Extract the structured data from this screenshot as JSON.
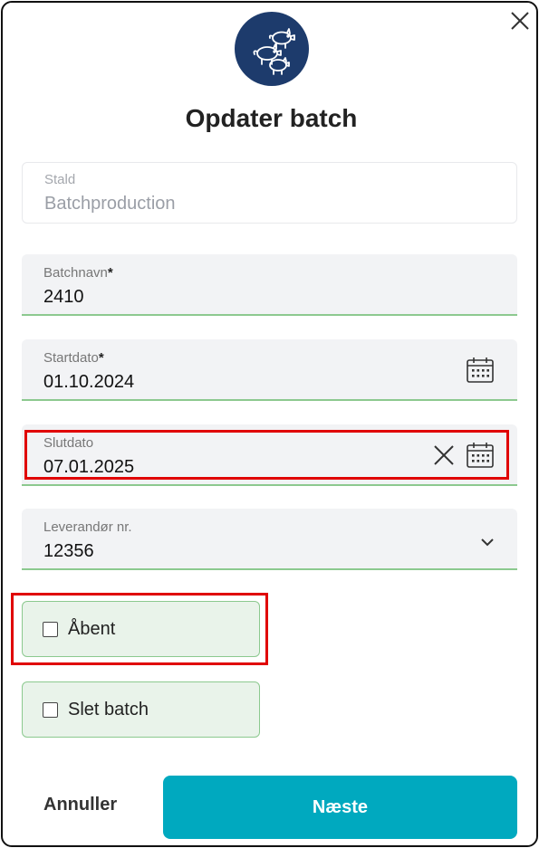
{
  "dialog": {
    "title": "Opdater batch",
    "icon": "pigs-icon",
    "accent_color": "#1d3b6c"
  },
  "fields": {
    "stald": {
      "label": "Stald",
      "value": "Batchproduction"
    },
    "batchnavn": {
      "label": "Batchnavn",
      "required": "*",
      "value": "2410"
    },
    "startdato": {
      "label": "Startdato",
      "required": "*",
      "value": "01.10.2024"
    },
    "slutdato": {
      "label": "Slutdato",
      "value": "07.01.2025"
    },
    "leverandor": {
      "label": "Leverandør nr.",
      "value": "12356"
    }
  },
  "checkboxes": {
    "aabent": {
      "label": "Åbent",
      "checked": false
    },
    "slet": {
      "label": "Slet batch",
      "checked": false
    }
  },
  "actions": {
    "cancel_label": "Annuller",
    "next_label": "Næste",
    "next_color": "#00a9bf"
  },
  "highlight_color": "#e00000"
}
